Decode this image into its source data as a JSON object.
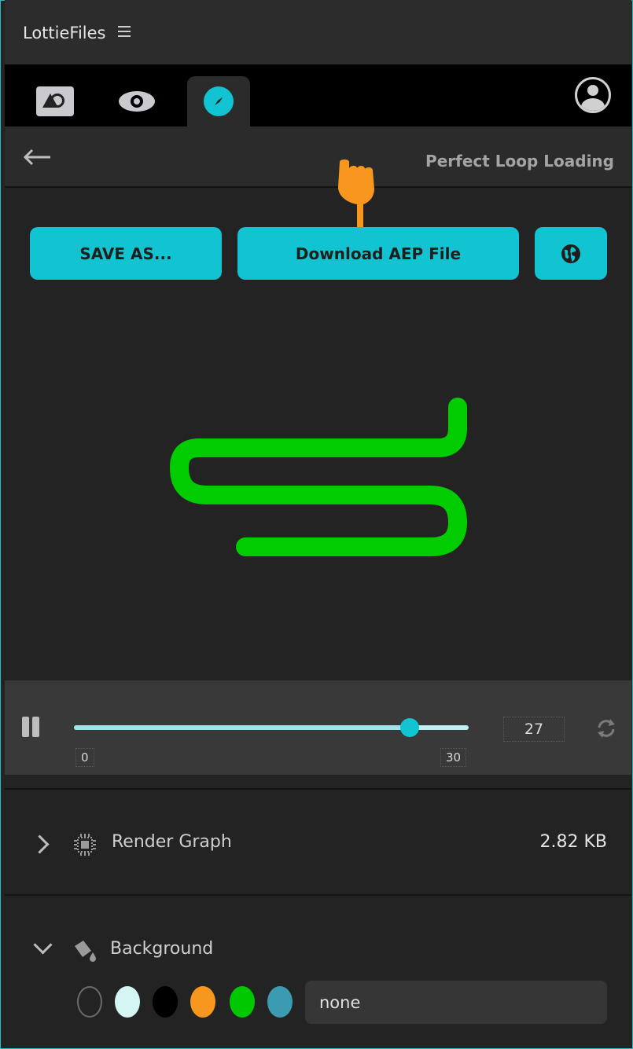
{
  "app": {
    "title": "LottieFiles"
  },
  "tabs": [
    {
      "name": "effects",
      "icon": "effects-icon"
    },
    {
      "name": "preview",
      "icon": "eye-icon"
    },
    {
      "name": "explore",
      "icon": "compass-icon",
      "active": true
    }
  ],
  "header": {
    "title": "Perfect Loop Loading"
  },
  "actions": {
    "save_label": "SAVE AS...",
    "download_label": "Download AEP File",
    "globe_icon": "globe-icon"
  },
  "player": {
    "start_frame": "0",
    "end_frame": "30",
    "current_frame": "27",
    "progress": 0.85
  },
  "render_graph": {
    "label": "Render Graph",
    "size": "2.82 KB"
  },
  "background": {
    "label": "Background",
    "swatches": [
      "transparent",
      "#d4f5f4",
      "#000000",
      "#f7971d",
      "#00c800",
      "#3b9bb0"
    ],
    "value": "none"
  },
  "colors": {
    "accent": "#12c3d1",
    "animation_stroke": "#00cc00",
    "cursor": "#f7971d"
  }
}
